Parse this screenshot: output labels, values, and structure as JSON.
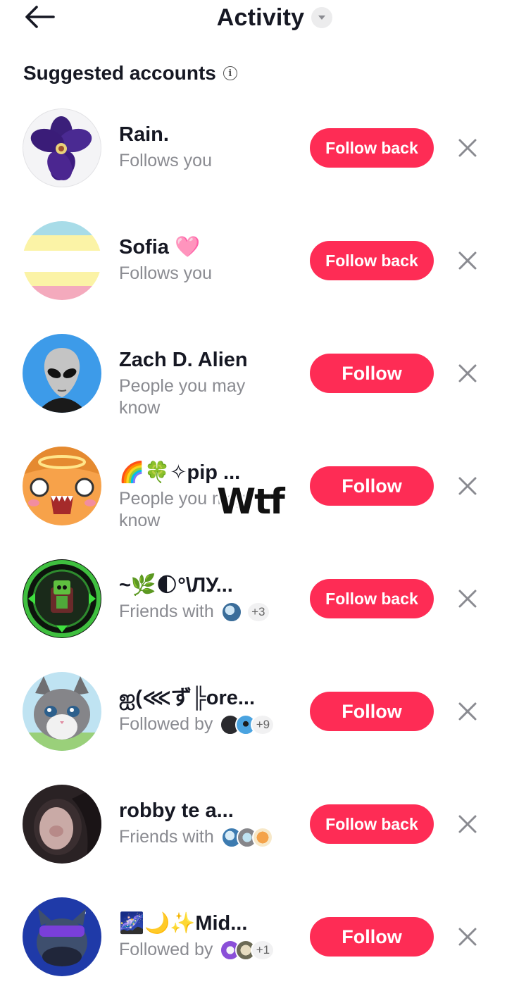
{
  "header": {
    "title": "Activity"
  },
  "section": {
    "title": "Suggested accounts"
  },
  "accounts": [
    {
      "name": "Rain.",
      "subtitle": "Follows you",
      "button": "Follow back",
      "avatar_icon": "purple-flower"
    },
    {
      "name": "Sofia 🩷",
      "subtitle": "Follows you",
      "button": "Follow back",
      "avatar_icon": "pastel-stripes"
    },
    {
      "name": "Zach D. Alien",
      "subtitle": "People you may know",
      "button": "Follow",
      "avatar_icon": "alien"
    },
    {
      "name": "🌈🍀✧pip ...",
      "subtitle": "People you may know",
      "button": "Follow",
      "avatar_icon": "orange-cat"
    },
    {
      "name": "~🌿🌓°\\ЛУ...",
      "subtitle": "Friends with",
      "extra": "+3",
      "button": "Follow back",
      "avatar_icon": "green-robot"
    },
    {
      "name": "ஐ(⋘ず╠ore...",
      "subtitle": "Followed by",
      "extra": "+9",
      "button": "Follow",
      "avatar_icon": "gray-cat"
    },
    {
      "name": "robby te a...",
      "subtitle": "Friends with",
      "button": "Follow back",
      "avatar_icon": "person-photo"
    },
    {
      "name": "🌌🌙✨Mid...",
      "subtitle": "Followed by",
      "extra": "+1",
      "button": "Follow",
      "avatar_icon": "cool-cat"
    }
  ],
  "sticker": {
    "text": "Wtf"
  },
  "colors": {
    "accent": "#fe2c55",
    "muted": "#8a8b91"
  }
}
